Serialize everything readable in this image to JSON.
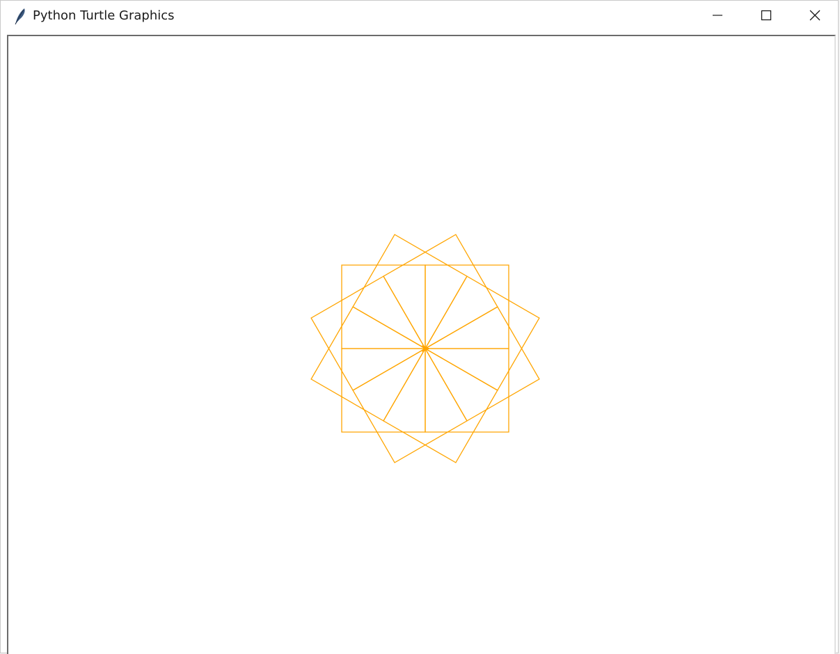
{
  "window": {
    "title": "Python Turtle Graphics",
    "app_icon": "feather-icon",
    "controls": {
      "minimize": "minimize-icon",
      "maximize": "maximize-icon",
      "close": "close-icon"
    }
  },
  "canvas": {
    "background": "#ffffff",
    "drawing": {
      "shape": "square",
      "count": 12,
      "side": 120,
      "rotation_step_degrees": 30,
      "pen_color": "#ffa500",
      "cursor_color": "#ffa500"
    }
  }
}
